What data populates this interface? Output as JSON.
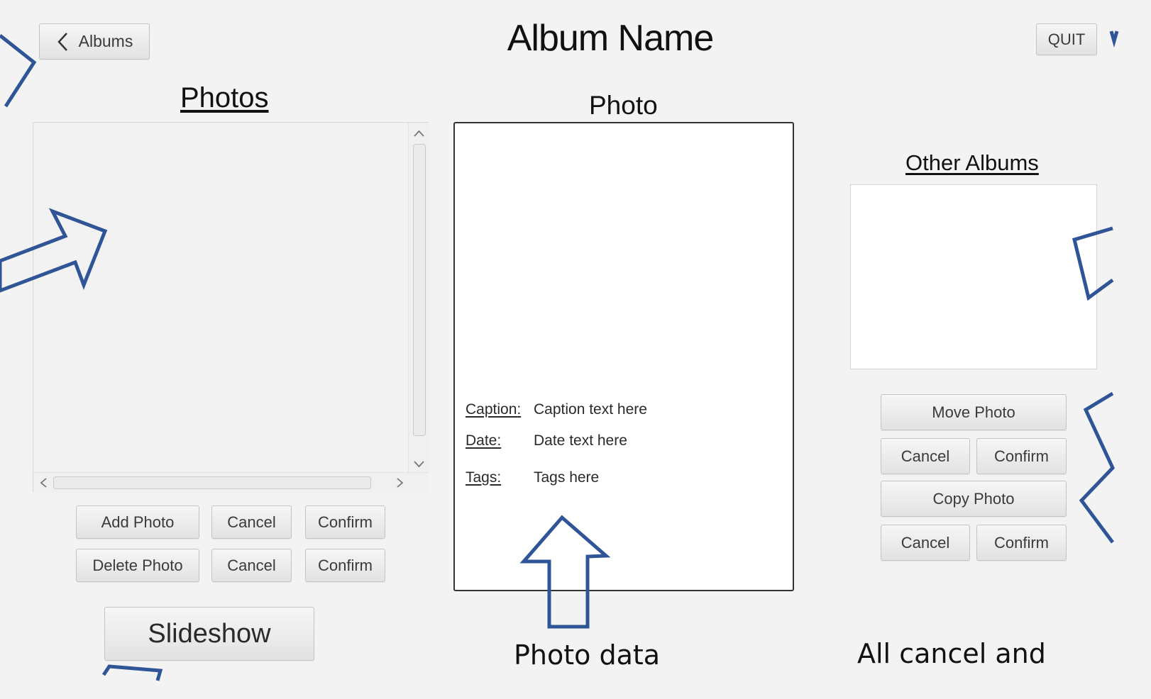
{
  "header": {
    "title": "Album Name",
    "back_label": "Albums",
    "quit_label": "QUIT"
  },
  "photos_panel": {
    "heading": "Photos",
    "add_photo_label": "Add Photo",
    "delete_photo_label": "Delete Photo",
    "cancel_label": "Cancel",
    "confirm_label": "Confirm",
    "slideshow_label": "Slideshow"
  },
  "photo_panel": {
    "heading": "Photo",
    "caption_label": "Caption:",
    "caption_value": "Caption text here",
    "date_label": "Date:",
    "date_value": "Date text here",
    "tags_label": "Tags:",
    "tags_value": "Tags here"
  },
  "other_albums_panel": {
    "heading": "Other Albums",
    "move_photo_label": "Move Photo",
    "copy_photo_label": "Copy Photo",
    "cancel_label": "Cancel",
    "confirm_label": "Confirm"
  },
  "annotations": {
    "photo_data": "Photo data",
    "all_cancel": "All cancel and"
  },
  "colors": {
    "window_bg": "#f3f3f3",
    "arrow_stroke": "#2f5597",
    "button_border": "#c4c4c4"
  }
}
